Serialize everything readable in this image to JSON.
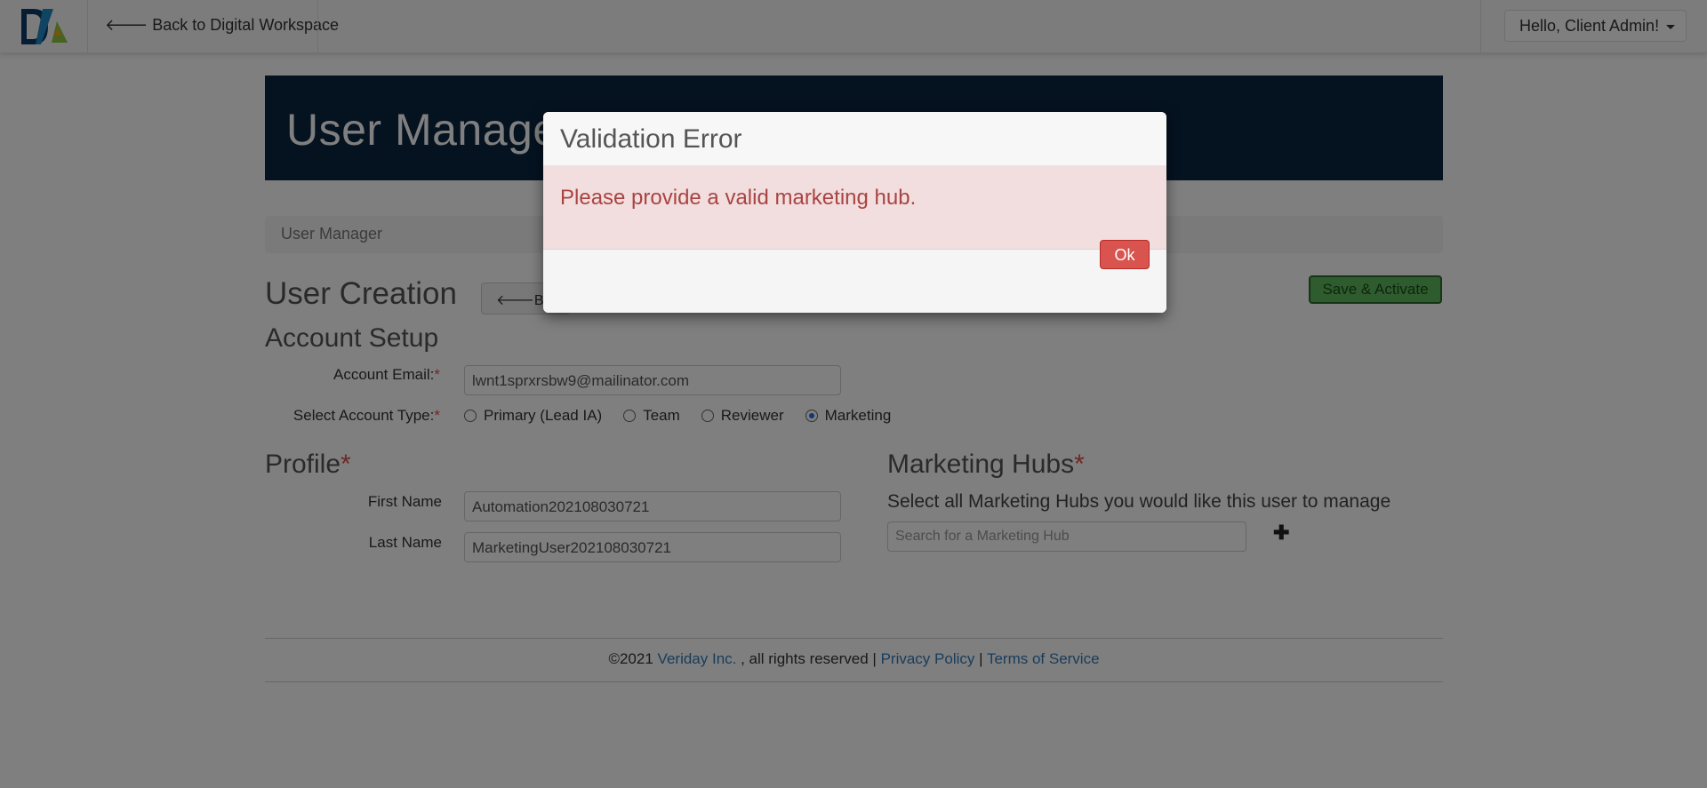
{
  "navbar": {
    "back_label": "🡐 Back to Digital Workspace",
    "user_menu_label": "Hello, Client Admin!"
  },
  "banner": {
    "title": "User Manager"
  },
  "breadcrumb": {
    "label": "User Manager"
  },
  "creation": {
    "heading": "User Creation",
    "back_button": "🡐Back",
    "save_button": "Save & Activate"
  },
  "account": {
    "heading": "Account Setup",
    "email_label": "Account Email:",
    "email_value": "lwnt1sprxrsbw9@mailinator.com",
    "type_label": "Select Account Type:",
    "types": [
      {
        "label": "Primary (Lead IA)",
        "selected": false
      },
      {
        "label": "Team",
        "selected": false
      },
      {
        "label": "Reviewer",
        "selected": false
      },
      {
        "label": "Marketing",
        "selected": true
      }
    ]
  },
  "profile": {
    "heading": "Profile",
    "first_label": "First Name",
    "first_value": "Automation202108030721",
    "last_label": "Last Name",
    "last_value": "MarketingUser202108030721"
  },
  "hubs": {
    "heading": "Marketing Hubs",
    "description": "Select all Marketing Hubs you would like this user to manage",
    "search_placeholder": "Search for a Marketing Hub"
  },
  "footer": {
    "copyright": "©2021",
    "company": "Veriday Inc.",
    "rights": " , all rights reserved | ",
    "privacy": "Privacy Policy",
    "sep": " | ",
    "terms": "Terms of Service"
  },
  "modal": {
    "title": "Validation Error",
    "message": "Please provide a valid marketing hub.",
    "ok_label": "Ok"
  },
  "colors": {
    "banner": "#0a2440",
    "error_bg": "#f2dede",
    "error_text": "#a94442",
    "ok_button": "#d9534f",
    "save_button": "#5cb85c",
    "link": "#337ab7"
  }
}
